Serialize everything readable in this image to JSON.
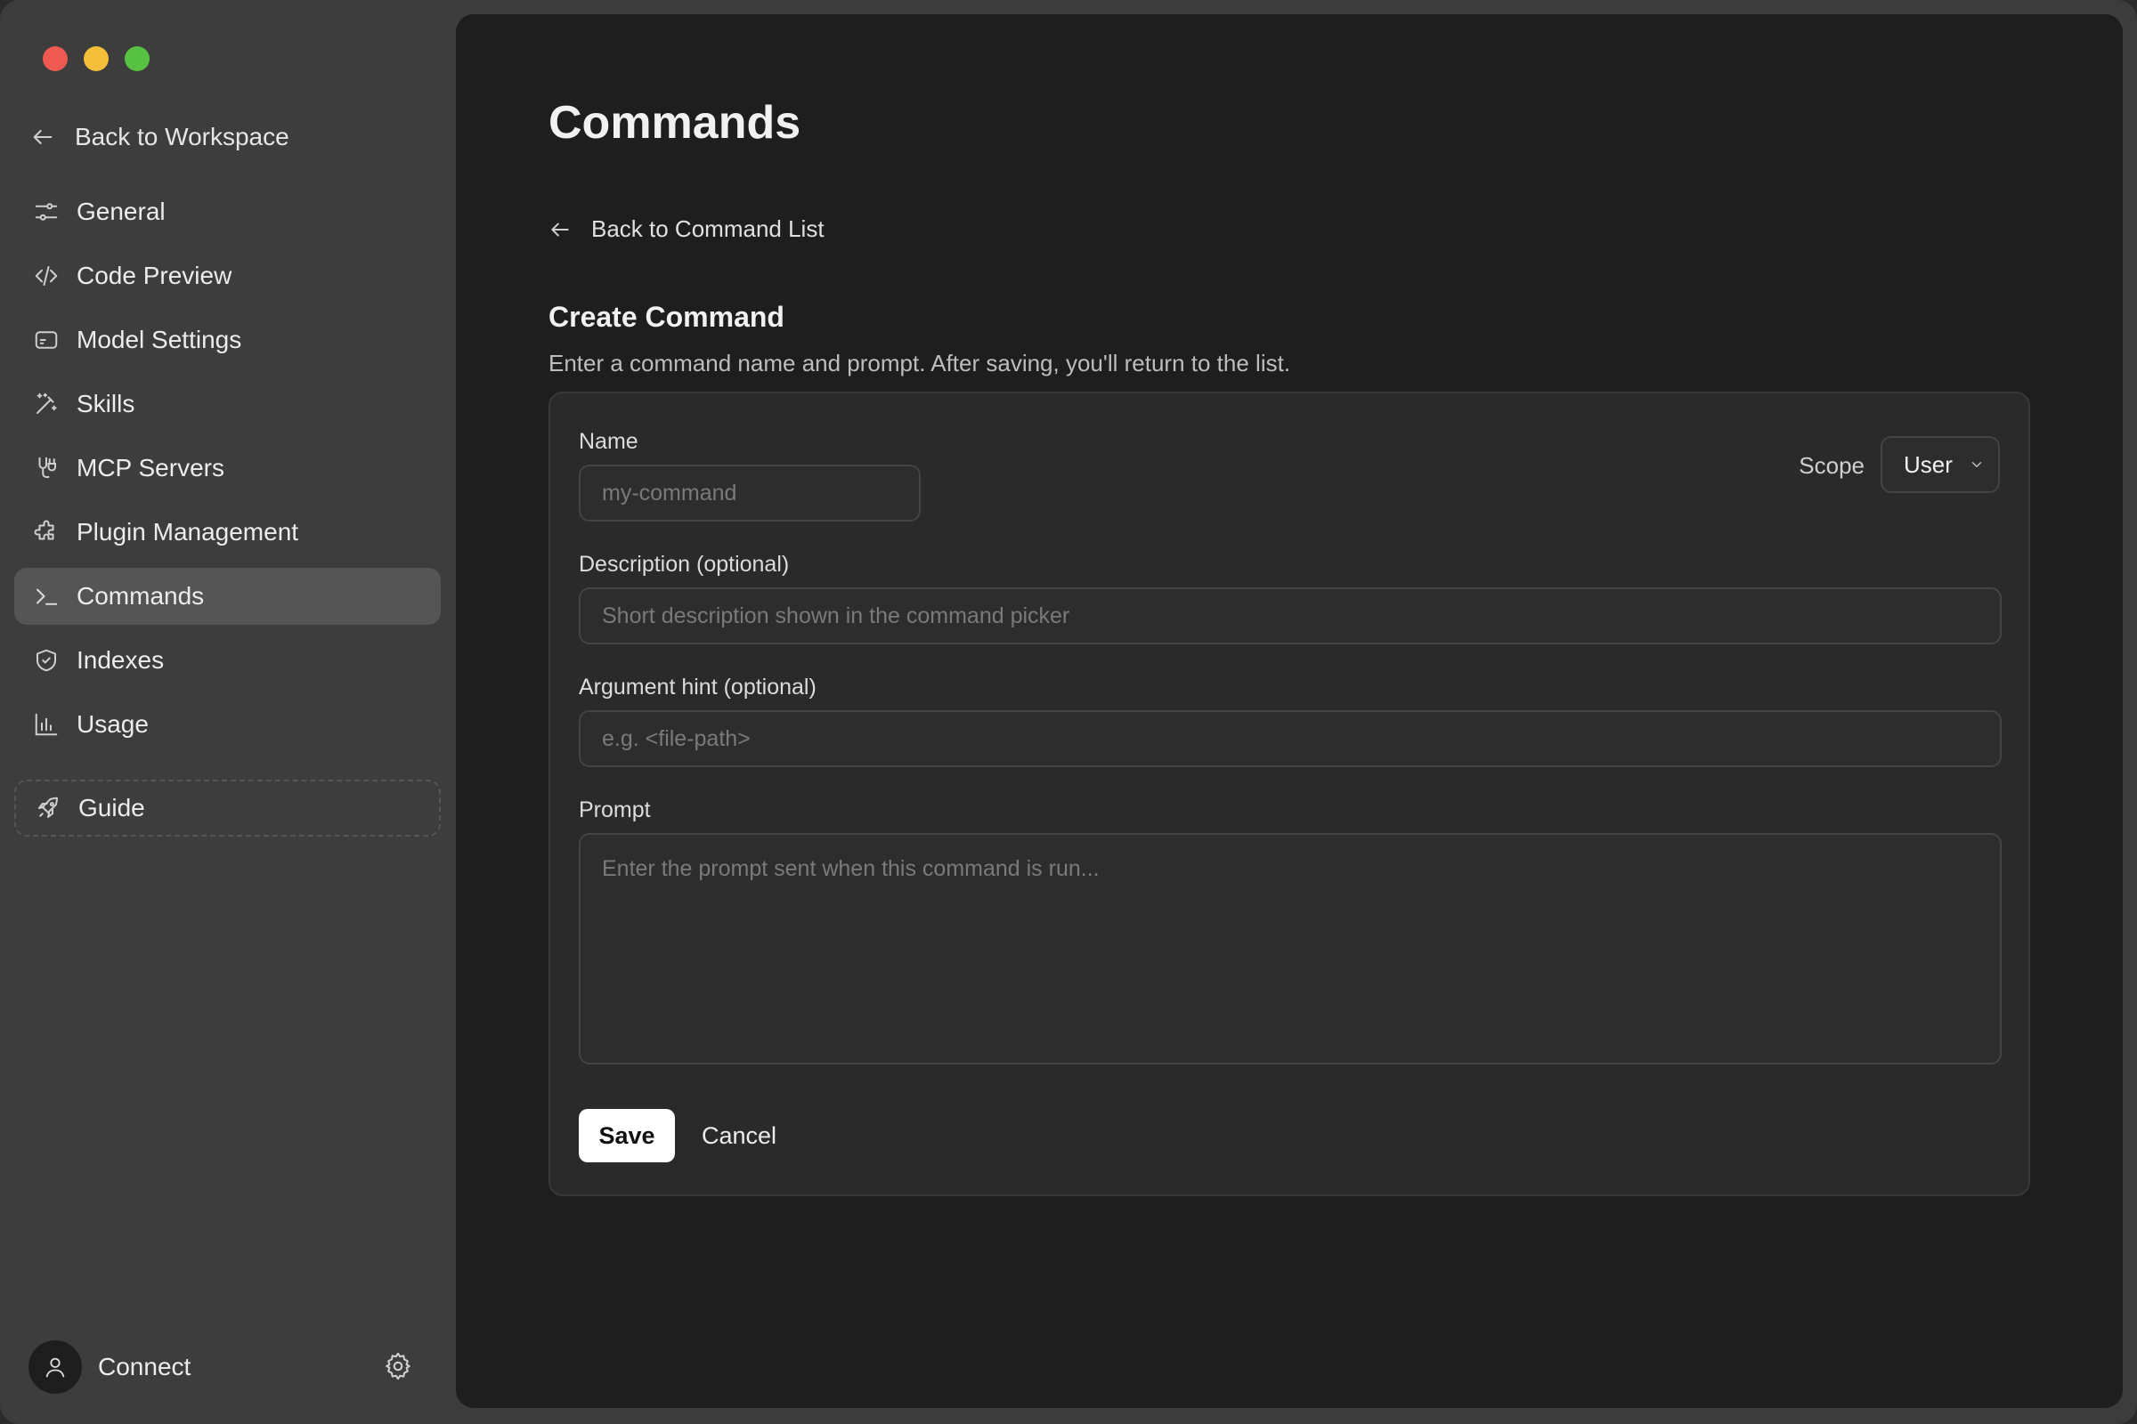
{
  "sidebar": {
    "back_label": "Back to Workspace",
    "items": [
      {
        "label": "General",
        "icon": "sliders-icon"
      },
      {
        "label": "Code Preview",
        "icon": "code-icon"
      },
      {
        "label": "Model Settings",
        "icon": "model-icon"
      },
      {
        "label": "Skills",
        "icon": "magic-wand-icon"
      },
      {
        "label": "MCP Servers",
        "icon": "server-plug-icon"
      },
      {
        "label": "Plugin Management",
        "icon": "puzzle-icon"
      },
      {
        "label": "Commands",
        "icon": "terminal-icon",
        "active": true
      },
      {
        "label": "Indexes",
        "icon": "shield-icon"
      },
      {
        "label": "Usage",
        "icon": "bar-chart-icon"
      }
    ],
    "guide_label": "Guide",
    "connect_label": "Connect"
  },
  "main": {
    "title": "Commands",
    "back_label": "Back to Command List",
    "section_title": "Create Command",
    "section_desc": "Enter a command name and prompt. After saving, you'll return to the list.",
    "form": {
      "name_label": "Name",
      "name_placeholder": "my-command",
      "scope_label": "Scope",
      "scope_value": "User",
      "description_label": "Description (optional)",
      "description_placeholder": "Short description shown in the command picker",
      "argument_label": "Argument hint (optional)",
      "argument_placeholder": "e.g. <file-path>",
      "prompt_label": "Prompt",
      "prompt_placeholder": "Enter the prompt sent when this command is run...",
      "save_label": "Save",
      "cancel_label": "Cancel"
    }
  },
  "colors": {
    "sidebar_bg": "#3d3d3d",
    "main_bg": "#1e1e1e",
    "card_bg": "#2a2a2a",
    "active_item": "#555555",
    "traffic_red": "#ee5a52",
    "traffic_yellow": "#f4bf3a",
    "traffic_green": "#57c142"
  }
}
